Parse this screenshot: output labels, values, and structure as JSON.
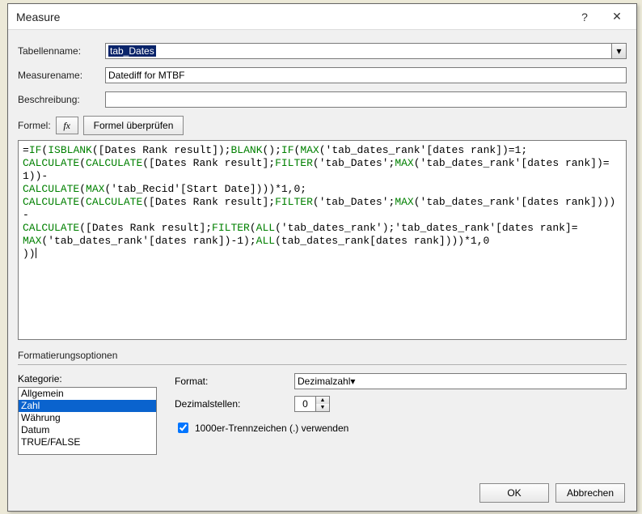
{
  "title": "Measure",
  "labels": {
    "tabellenname": "Tabellenname:",
    "measurename": "Measurename:",
    "beschreibung": "Beschreibung:",
    "formel": "Formel:",
    "fx": "fx",
    "formel_pruefen": "Formel überprüfen",
    "format_optionen": "Formatierungsoptionen",
    "kategorie": "Kategorie:",
    "format": "Format:",
    "dezimalstellen": "Dezimalstellen:",
    "thousand_sep": "1000er-Trennzeichen (.) verwenden"
  },
  "fields": {
    "tabellenname": "tab_Dates",
    "measurename": "Datediff for MTBF",
    "beschreibung": "",
    "format_value": "Dezimalzahl",
    "decimals": "0"
  },
  "kategorie_items": [
    "Allgemein",
    "Zahl",
    "Währung",
    "Datum",
    "TRUE/FALSE"
  ],
  "kategorie_selected": 1,
  "buttons": {
    "ok": "OK",
    "cancel": "Abbrechen"
  },
  "formula_tokens": [
    {
      "t": "txt",
      "v": "="
    },
    {
      "t": "fn",
      "v": "IF"
    },
    {
      "t": "txt",
      "v": "("
    },
    {
      "t": "fn",
      "v": "ISBLANK"
    },
    {
      "t": "txt",
      "v": "([Dates Rank result]);"
    },
    {
      "t": "fn",
      "v": "BLANK"
    },
    {
      "t": "txt",
      "v": "();"
    },
    {
      "t": "fn",
      "v": "IF"
    },
    {
      "t": "txt",
      "v": "("
    },
    {
      "t": "fn",
      "v": "MAX"
    },
    {
      "t": "txt",
      "v": "('tab_dates_rank'[dates rank])=1;"
    },
    {
      "t": "br"
    },
    {
      "t": "fn",
      "v": "CALCULATE"
    },
    {
      "t": "txt",
      "v": "("
    },
    {
      "t": "fn",
      "v": "CALCULATE"
    },
    {
      "t": "txt",
      "v": "([Dates Rank result];"
    },
    {
      "t": "fn",
      "v": "FILTER"
    },
    {
      "t": "txt",
      "v": "('tab_Dates';"
    },
    {
      "t": "fn",
      "v": "MAX"
    },
    {
      "t": "txt",
      "v": "('tab_dates_rank'[dates rank])=1))-"
    },
    {
      "t": "br"
    },
    {
      "t": "fn",
      "v": "CALCULATE"
    },
    {
      "t": "txt",
      "v": "("
    },
    {
      "t": "fn",
      "v": "MAX"
    },
    {
      "t": "txt",
      "v": "('tab_Recid'[Start Date])))*1,0;"
    },
    {
      "t": "br"
    },
    {
      "t": "fn",
      "v": "CALCULATE"
    },
    {
      "t": "txt",
      "v": "("
    },
    {
      "t": "fn",
      "v": "CALCULATE"
    },
    {
      "t": "txt",
      "v": "([Dates Rank result];"
    },
    {
      "t": "fn",
      "v": "FILTER"
    },
    {
      "t": "txt",
      "v": "('tab_Dates';"
    },
    {
      "t": "fn",
      "v": "MAX"
    },
    {
      "t": "txt",
      "v": "('tab_dates_rank'[dates rank])))-"
    },
    {
      "t": "br"
    },
    {
      "t": "fn",
      "v": "CALCULATE"
    },
    {
      "t": "txt",
      "v": "([Dates Rank result];"
    },
    {
      "t": "fn",
      "v": "FILTER"
    },
    {
      "t": "txt",
      "v": "("
    },
    {
      "t": "fn",
      "v": "ALL"
    },
    {
      "t": "txt",
      "v": "('tab_dates_rank');'tab_dates_rank'[dates rank]="
    },
    {
      "t": "br"
    },
    {
      "t": "fn",
      "v": "MAX"
    },
    {
      "t": "txt",
      "v": "('tab_dates_rank'[dates rank])-1);"
    },
    {
      "t": "fn",
      "v": "ALL"
    },
    {
      "t": "txt",
      "v": "(tab_dates_rank[dates rank])))*1,0"
    },
    {
      "t": "br"
    },
    {
      "t": "txt",
      "v": "))"
    },
    {
      "t": "caret"
    }
  ]
}
